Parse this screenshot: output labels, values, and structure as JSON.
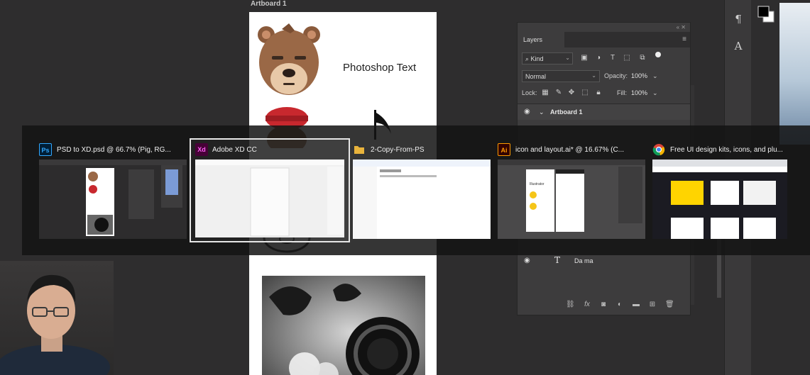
{
  "workspace": {
    "artboard_label": "Artboard 1",
    "artboard_text": "Photoshop Text"
  },
  "layers_panel": {
    "tab_label": "Layers",
    "kind_filter": "Kind",
    "blend_mode": "Normal",
    "opacity_label": "Opacity:",
    "opacity_value": "100%",
    "lock_label": "Lock:",
    "fill_label": "Fill:",
    "fill_value": "100%",
    "layers": [
      {
        "name": "Artboard 1"
      },
      {
        "name": "Da ma"
      }
    ]
  },
  "task_switcher": {
    "windows": [
      {
        "app": "Ps",
        "title": "PSD to XD.psd @ 66.7% (Pig, RG...",
        "icon_color": "#001e36",
        "icon_text_color": "#31a8ff",
        "selected": false
      },
      {
        "app": "Xd",
        "title": "Adobe XD CC",
        "icon_color": "#470137",
        "icon_text_color": "#ff61f6",
        "selected": true
      },
      {
        "app": "folder-icon",
        "title": "2-Copy-From-PS",
        "icon_color": "#e8b33c",
        "selected": false
      },
      {
        "app": "Ai",
        "title": "icon and layout.ai* @ 16.67% (C...",
        "icon_color": "#330000",
        "icon_text_color": "#ff9a00",
        "selected": false
      },
      {
        "app": "chrome-icon",
        "title": "Free UI design kits, icons, and plu...",
        "icon_color": "#ffffff",
        "selected": false
      }
    ],
    "thumb_texts": {
      "illustrator_brand": "Illustrator"
    }
  },
  "colors": {
    "workspace_bg": "#2e2d2e",
    "panel_bg": "#3d3c3d",
    "selection_outline": "#e6e6e6"
  }
}
